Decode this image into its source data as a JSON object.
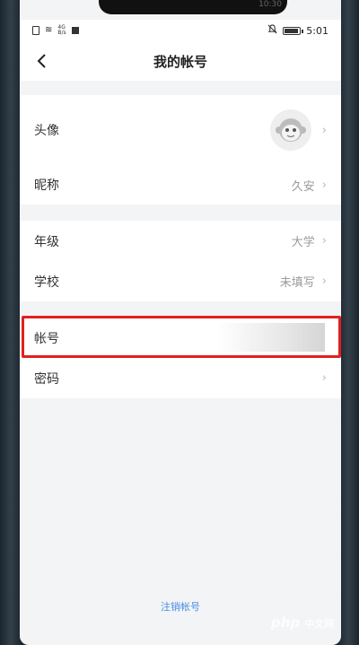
{
  "status_bar": {
    "network_label_top": "4G",
    "network_label_bottom": "B/s",
    "time": "5:01",
    "notch_time": "10:30"
  },
  "nav": {
    "title": "我的帐号"
  },
  "profile_group": [
    {
      "label": "头像",
      "value": ""
    },
    {
      "label": "昵称",
      "value": "久安"
    }
  ],
  "school_group": [
    {
      "label": "年级",
      "value": "大学"
    },
    {
      "label": "学校",
      "value": "未填写"
    }
  ],
  "account_group": [
    {
      "label": "帐号",
      "value": ""
    },
    {
      "label": "密码",
      "value": ""
    }
  ],
  "footer": {
    "logout_label": "注销帐号"
  },
  "watermark": {
    "main": "php",
    "sub": "中文网"
  },
  "colors": {
    "highlight": "#e12020",
    "link": "#4a8fe2",
    "page_bg": "#f3f4f6"
  }
}
